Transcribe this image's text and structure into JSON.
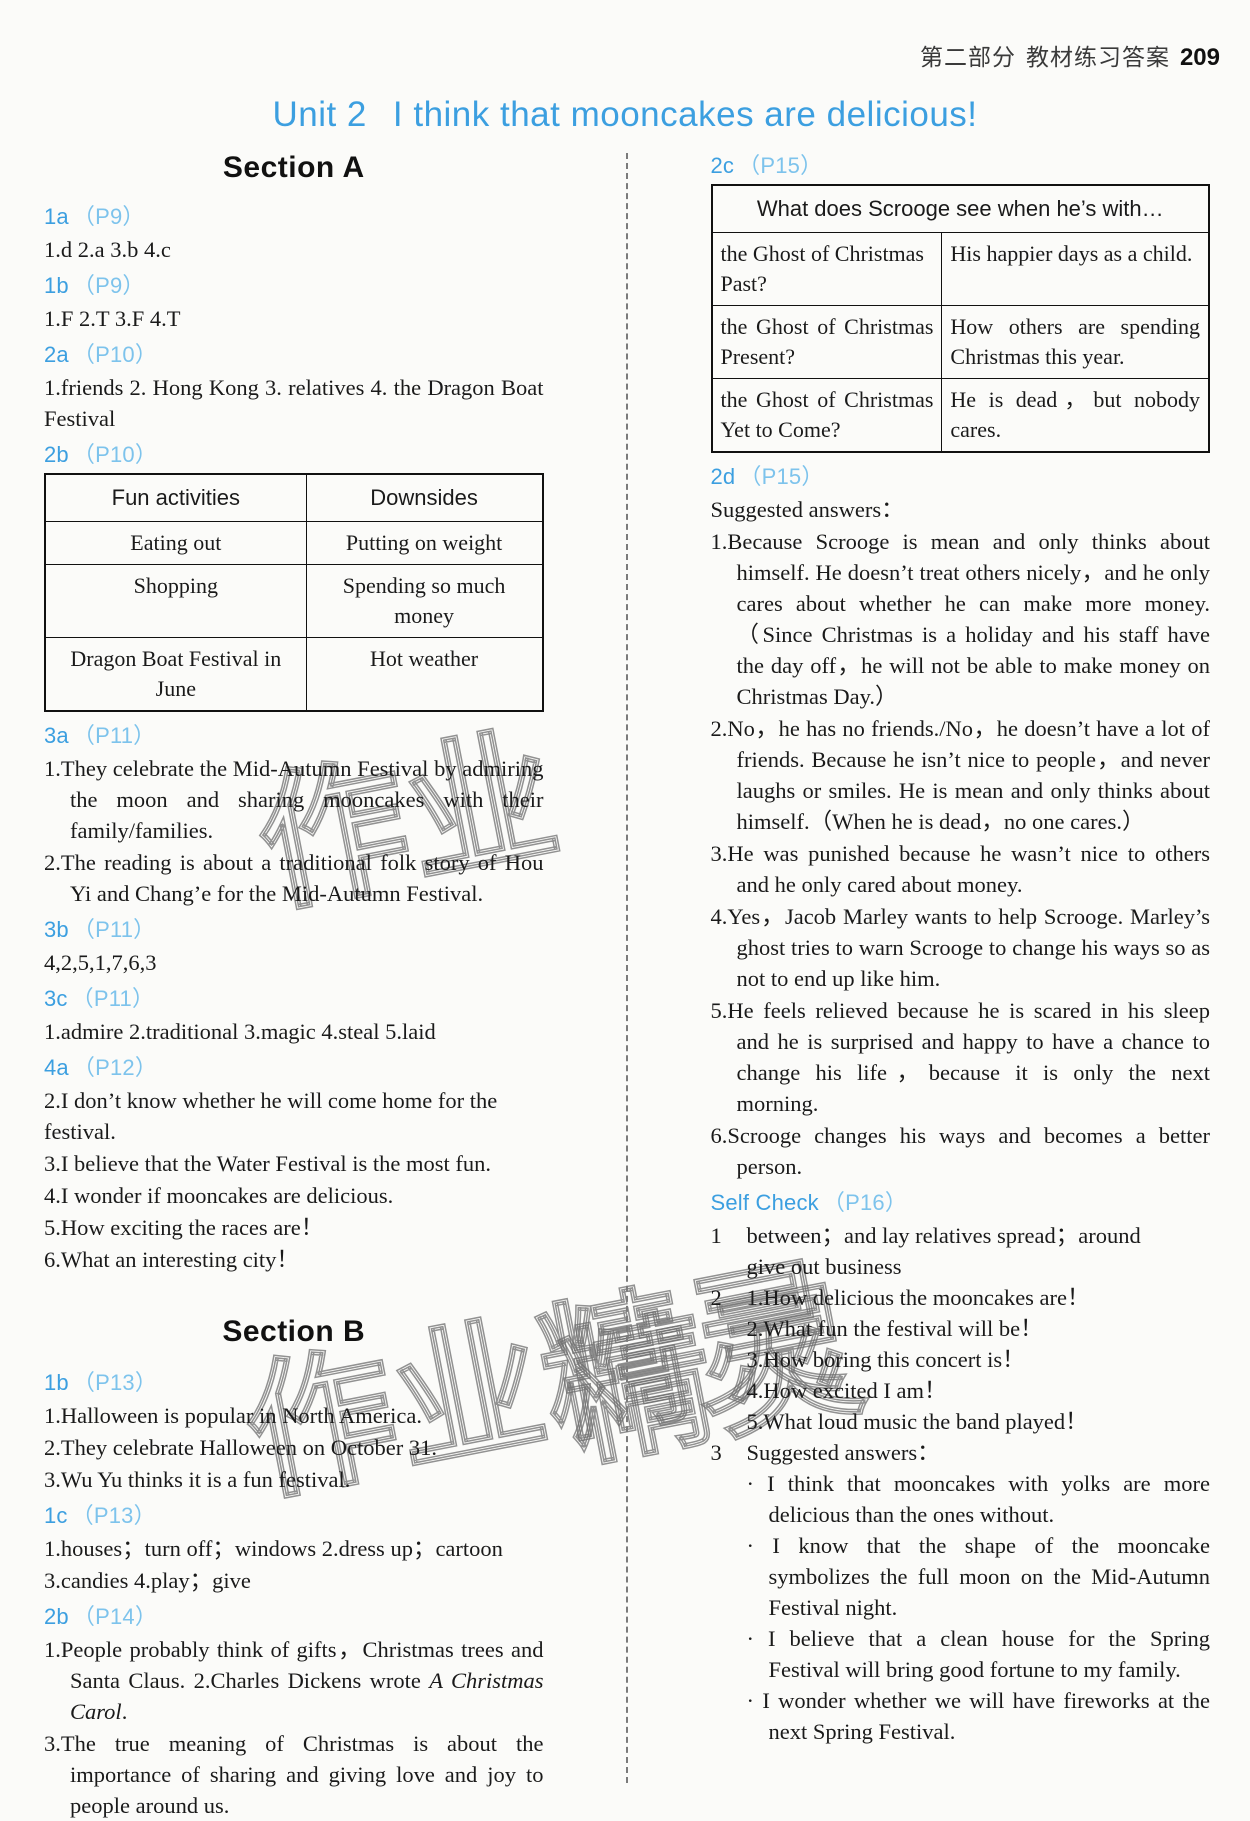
{
  "header": {
    "chapter": "第二部分",
    "title": "教材练习答案",
    "page_number": "209"
  },
  "unit": {
    "label": "Unit 2",
    "title": "I think that mooncakes are delicious!"
  },
  "watermark": {
    "text_1": "作业",
    "text_2": "作业精灵",
    "text_3": "精灵"
  },
  "section_a": {
    "heading": "Section A",
    "items": [
      {
        "label": "1a",
        "page": "（P9）",
        "lines": [
          "1.d   2.a  3.b  4.c"
        ]
      },
      {
        "label": "1b",
        "page": "（P9）",
        "lines": [
          "1.F   2.T   3.F  4.T"
        ]
      },
      {
        "label": "2a",
        "page": "（P10）",
        "lines": [
          "1.friends      2. Hong  Kong      3. relatives      4. the  Dragon  Boat  Festival"
        ]
      },
      {
        "label": "2b",
        "page": "（P10）",
        "lines": []
      }
    ],
    "table_2b": {
      "headers": [
        "Fun activities",
        "Downsides"
      ],
      "rows": [
        [
          "Eating out",
          "Putting on weight"
        ],
        [
          "Shopping",
          "Spending so much money"
        ],
        [
          "Dragon Boat Festival in June",
          "Hot weather"
        ]
      ]
    },
    "item_3a": {
      "label": "3a",
      "page": "（P11）"
    },
    "lines_3a": [
      "1.They celebrate the Mid-Autumn Festival by admiring the moon and sharing mooncakes with their family/families.",
      "2.The reading is about a traditional folk story of Hou Yi and Chang’e for the Mid-Autumn Festival."
    ],
    "item_3b": {
      "label": "3b",
      "page": "（P11）"
    },
    "lines_3b": [
      "4,2,5,1,7,6,3"
    ],
    "item_3c": {
      "label": "3c",
      "page": "（P11）"
    },
    "lines_3c": [
      "1.admire    2.traditional   3.magic    4.steal   5.laid"
    ],
    "item_4a": {
      "label": "4a",
      "page": "（P12）"
    },
    "lines_4a": [
      "2.I don’t know whether he will come home for the festival.",
      "3.I believe that the Water Festival is the most fun.",
      "4.I wonder if mooncakes are delicious.",
      "5.How exciting the races are！",
      "6.What an interesting city！"
    ]
  },
  "section_b": {
    "heading": "Section B",
    "item_1b": {
      "label": "1b",
      "page": "（P13）"
    },
    "lines_1b": [
      "1.Halloween is popular in North America.",
      "2.They celebrate Halloween on October 31.",
      "3.Wu Yu thinks it is a fun festival."
    ],
    "item_1c": {
      "label": "1c",
      "page": "（P13）"
    },
    "lines_1c": [
      "1.houses；turn off；windows    2.dress up；cartoon",
      "3.candies    4.play；give"
    ],
    "item_2b": {
      "label": "2b",
      "page": "（P14）"
    },
    "lines_2b_part1": "1.People probably think of gifts，Christmas trees and Santa Claus.   2.Charles Dickens wrote ",
    "lines_2b_italic": "A Christmas Carol",
    "lines_2b_part2": ".",
    "lines_2b_3": "3.The true meaning of Christmas is about the importance of sharing and giving love and joy to people around us."
  },
  "right_column": {
    "item_2c": {
      "label": "2c",
      "page": "（P15）"
    },
    "table_2c": {
      "header": "What does Scrooge see when he’s with…",
      "rows": [
        [
          "the Ghost of Christmas Past?",
          "His happier days as a child."
        ],
        [
          "the Ghost of Christmas Present?",
          "How others are spending Christmas this year."
        ],
        [
          "the Ghost of Christmas Yet to Come?",
          "He is dead，but nobody cares."
        ]
      ]
    },
    "item_2d": {
      "label": "2d",
      "page": "（P15）"
    },
    "suggested_label": "Suggested answers：",
    "lines_2d": [
      "1.Because Scrooge is mean and only thinks about himself. He doesn’t treat others nicely，and he only cares about whether he can make more money.（Since Christmas is a holiday and his staff have the day off，he will not be able to make money on Christmas Day.）",
      "2.No，he has no friends./No，he doesn’t have a lot of friends. Because he isn’t nice to people，and never laughs or smiles. He is mean and only thinks about himself.（When he is dead，no one cares.）",
      "3.He was punished because he wasn’t nice to others and he only cared about money.",
      "4.Yes，Jacob Marley wants to help Scrooge. Marley’s ghost tries to warn Scrooge to change his ways so as not to end up like him.",
      "5.He feels relieved because he is scared in his sleep and he is surprised and happy to have a chance to change his life，because it is only the next morning.",
      "6.Scrooge changes his ways and becomes a better person."
    ],
    "item_self_check": {
      "label": "Self Check",
      "page": "（P16）"
    },
    "self_check": [
      {
        "index": "1",
        "lines": [
          "between；and    lay   relatives    spread；around",
          "give out   business"
        ]
      },
      {
        "index": "2",
        "lines": [
          "1.How delicious the mooncakes are！",
          "2.What fun the festival will be！",
          "3.How boring this concert is！",
          "4.How excited I am！",
          "5.What loud music the band played！"
        ]
      },
      {
        "index": "3",
        "lines": [
          "Suggested answers："
        ],
        "bullets": [
          "· I think that mooncakes with yolks are more delicious than the ones without.",
          "· I know that the shape of the mooncake symbolizes the full moon on the Mid-Autumn Festival night.",
          "· I believe that a clean house for the Spring Festival will bring good fortune to my family.",
          "· I wonder whether we will have fireworks at the next Spring Festival."
        ]
      }
    ]
  }
}
